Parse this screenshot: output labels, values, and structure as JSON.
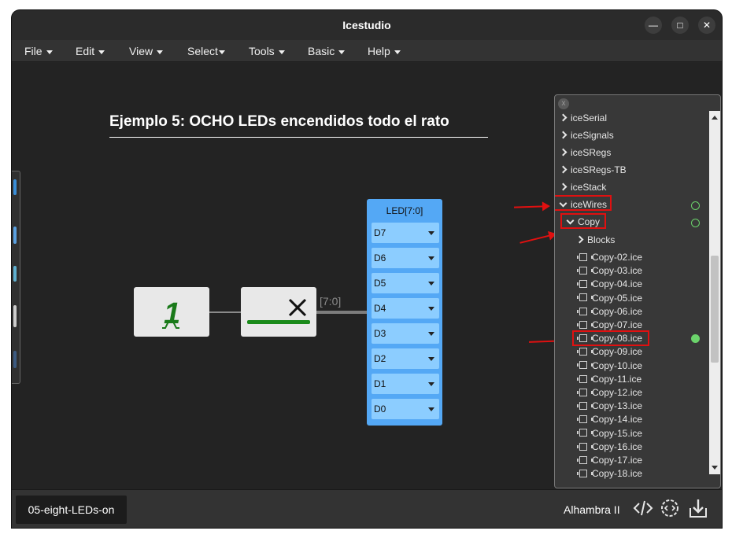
{
  "window": {
    "title": "Icestudio"
  },
  "titlebar": {
    "minimize_icon": "—",
    "maximize_icon": "□",
    "close_icon": "✕"
  },
  "menu": [
    {
      "label": "File"
    },
    {
      "label": "Edit"
    },
    {
      "label": "View"
    },
    {
      "label": "Select"
    },
    {
      "label": "Tools"
    },
    {
      "label": "Basic"
    },
    {
      "label": "Help"
    }
  ],
  "canvas": {
    "title": "Ejemplo 5: OCHO LEDs encendidos todo el rato",
    "constant_block": {
      "value": "1",
      "icon": "constant-one-icon"
    },
    "bus_block": {
      "icon": "close-x-icon"
    },
    "bus_label": "[7:0]",
    "led_block": {
      "title": "LED[7:0]",
      "pins": [
        "D7",
        "D6",
        "D5",
        "D4",
        "D3",
        "D2",
        "D1",
        "D0"
      ]
    }
  },
  "panel": {
    "close_label": "x",
    "items": [
      {
        "label": "iceSerial",
        "state": "collapsed"
      },
      {
        "label": "iceSignals",
        "state": "collapsed"
      },
      {
        "label": "iceSRegs",
        "state": "collapsed"
      },
      {
        "label": "iceSRegs-TB",
        "state": "collapsed"
      },
      {
        "label": "iceStack",
        "state": "collapsed"
      },
      {
        "label": "iceWires",
        "state": "expanded"
      },
      {
        "label": "Copy",
        "state": "expanded"
      },
      {
        "label": "Blocks",
        "state": "collapsed"
      }
    ],
    "files": [
      "Copy-02.ice",
      "Copy-03.ice",
      "Copy-04.ice",
      "Copy-05.ice",
      "Copy-06.ice",
      "Copy-07.ice",
      "Copy-08.ice",
      "Copy-09.ice",
      "Copy-10.ice",
      "Copy-11.ice",
      "Copy-12.ice",
      "Copy-13.ice",
      "Copy-14.ice",
      "Copy-15.ice",
      "Copy-16.ice",
      "Copy-17.ice",
      "Copy-18.ice"
    ]
  },
  "status": {
    "tab_label": "05-eight-LEDs-on",
    "board": "Alhambra II",
    "icons": [
      "code-icon",
      "settings-code-icon",
      "upload-icon"
    ]
  },
  "colors": {
    "accent_blue": "#54a8f5",
    "annotation_red": "#e01010",
    "status_green": "#6bd36b"
  }
}
